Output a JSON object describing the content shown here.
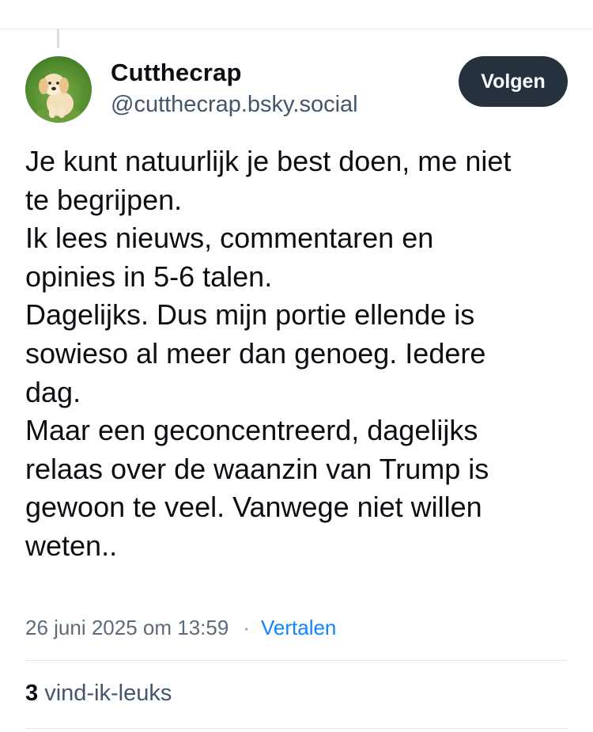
{
  "author": {
    "display_name": "Cutthecrap",
    "handle": "@cutthecrap.bsky.social",
    "avatar_icon": "puppy-avatar-icon"
  },
  "follow_button": {
    "label": "Volgen"
  },
  "post": {
    "lines": [
      "Je kunt natuurlijk je best doen, me niet",
      "te begrijpen.",
      "Ik lees nieuws, commentaren en",
      "opinies in 5-6 talen.",
      "Dagelijks. Dus mijn portie ellende is",
      "sowieso al meer dan genoeg. Iedere",
      "dag.",
      "Maar een geconcentreerd, dagelijks",
      "relaas over de waanzin van Trump is",
      "gewoon te veel. Vanwege niet willen",
      "weten.."
    ],
    "timestamp": "26 juni 2025 om 13:59",
    "separator": "·",
    "translate_label": "Vertalen"
  },
  "stats": {
    "likes_count": "3",
    "likes_label": "vind-ik-leuks"
  },
  "colors": {
    "follow_bg": "#25313d",
    "link": "#1083fe",
    "secondary_text": "#42576c"
  }
}
